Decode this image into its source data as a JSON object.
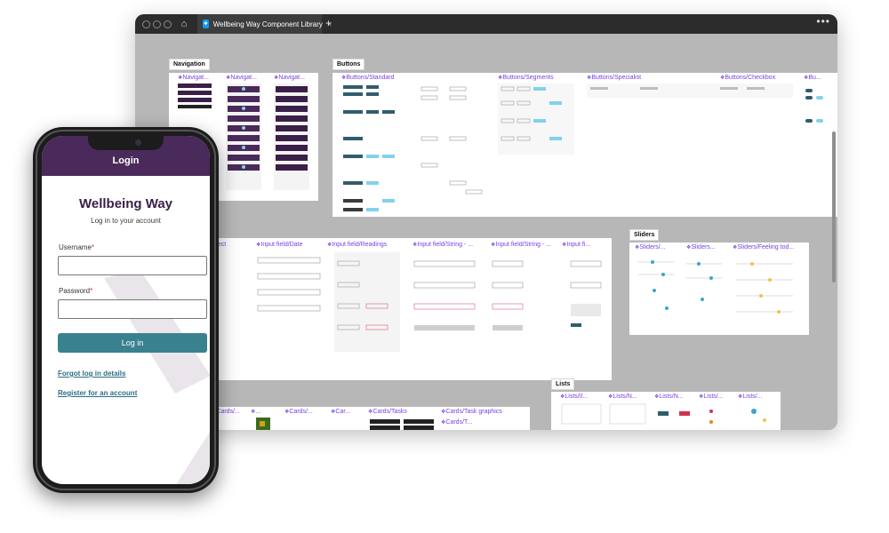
{
  "window": {
    "tab_title": "Wellbeing Way Component Library",
    "tab_close": "×",
    "new_tab": "+",
    "more": "•••",
    "home_icon": "home-icon"
  },
  "canvas": {
    "sections": {
      "navigation": "Navigation",
      "buttons": "Buttons",
      "sliders": "Sliders",
      "lists": "Lists"
    },
    "components": {
      "navigation": [
        "Navigat...",
        "Navigat...",
        "Navigat..."
      ],
      "buttons": [
        "Buttons/Standard",
        "Buttons/Segments",
        "Buttons/Specialist",
        "Buttons/Checkbox",
        "Bu..."
      ],
      "inputs": [
        "elect",
        "Input field/Date",
        "Input field/Readings",
        "Input field/String - ...",
        "Input field/String - ...",
        "Input fi..."
      ],
      "sliders": [
        "Sliders/...",
        "Sliders...",
        "Sliders/Feeling tod..."
      ],
      "cards": [
        "Cards/...",
        "...",
        "Cards/...",
        "Car...",
        "Cards/Tasks",
        "Cards/Task graphics",
        "Cards/T..."
      ],
      "lists": [
        "Lists/Il...",
        "Lists/N...",
        "Lists/N...",
        "Lists/...",
        "Lists/..."
      ]
    }
  },
  "phone": {
    "app_bar_title": "Login",
    "brand": "Wellbeing Way",
    "subtitle": "Log in to your account",
    "username_label": "Username",
    "password_label": "Password",
    "required_mark": "*",
    "username_value": "",
    "password_value": "",
    "login_button": "Log in",
    "forgot_link": "Forgot log in details",
    "register_link": "Register for an account"
  },
  "colors": {
    "app_bar": "#4a2a5a",
    "primary_button": "#3a8190",
    "link": "#2b6f85",
    "component_label": "#7b3fe4",
    "window_chrome": "#2c2c2c",
    "canvas": "#b7b7b7"
  }
}
